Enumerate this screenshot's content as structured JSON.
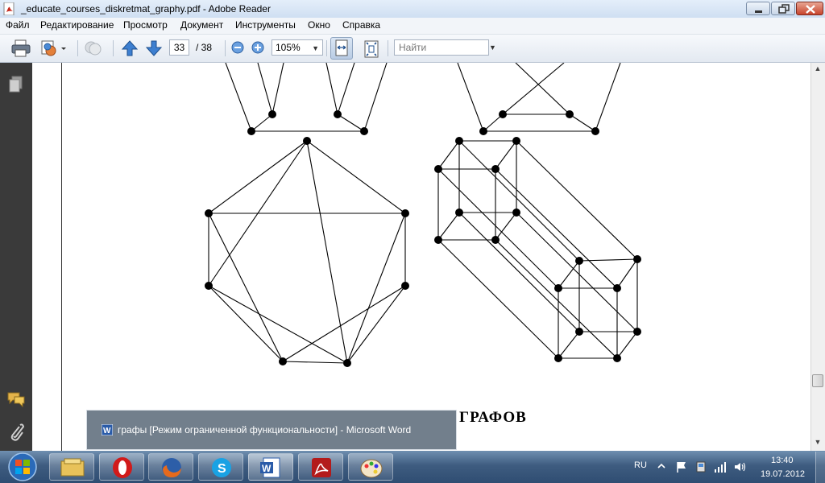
{
  "window": {
    "title": "_educate_courses_diskretmat_graphy.pdf - Adobe Reader"
  },
  "menu": {
    "items": [
      {
        "label": "Файл"
      },
      {
        "label": "Редактирование"
      },
      {
        "label": "Просмотр"
      },
      {
        "label": "Документ"
      },
      {
        "label": "Инструменты"
      },
      {
        "label": "Окно"
      },
      {
        "label": "Справка"
      }
    ]
  },
  "toolbar": {
    "page_current": "33",
    "page_total": "/ 38",
    "zoom": "105%",
    "search_placeholder": "Найти"
  },
  "document": {
    "heading": "ГРАФОВ"
  },
  "taskbar": {
    "popup_title": "графы [Режим ограниченной функциональности] - Microsoft Word",
    "language": "RU",
    "time": "13:40",
    "date": "19.07.2012"
  },
  "colors": {
    "title_bar": "#d6e4f5",
    "nav_panel": "#3a3a3a",
    "taskbar": "#3e5c80"
  }
}
